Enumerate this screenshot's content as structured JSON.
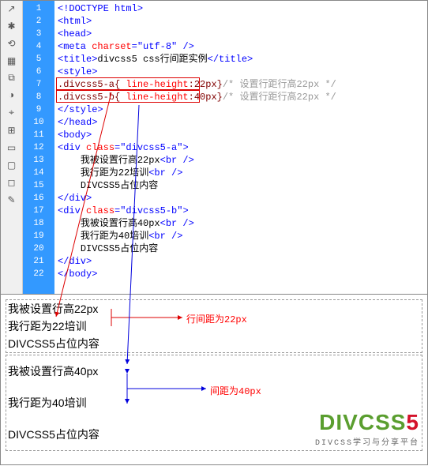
{
  "editor": {
    "line_count": 22,
    "lines": [
      {
        "indent": 0,
        "parts": [
          {
            "cls": "t-blue",
            "t": "<!DOCTYPE html>"
          }
        ]
      },
      {
        "indent": 0,
        "parts": [
          {
            "cls": "t-blue",
            "t": "<html>"
          }
        ]
      },
      {
        "indent": 0,
        "parts": [
          {
            "cls": "t-blue",
            "t": "<head>"
          }
        ]
      },
      {
        "indent": 0,
        "parts": [
          {
            "cls": "t-blue",
            "t": "<meta "
          },
          {
            "cls": "t-red",
            "t": "charset"
          },
          {
            "cls": "t-blue",
            "t": "="
          },
          {
            "cls": "t-blue",
            "t": "\"utf-8\""
          },
          {
            "cls": "t-blue",
            "t": " />"
          }
        ]
      },
      {
        "indent": 0,
        "parts": [
          {
            "cls": "t-blue",
            "t": "<title>"
          },
          {
            "cls": "t-black",
            "t": "divcss5 css行间距实例"
          },
          {
            "cls": "t-blue",
            "t": "</title>"
          }
        ]
      },
      {
        "indent": 0,
        "parts": [
          {
            "cls": "t-blue",
            "t": "<style>"
          }
        ]
      },
      {
        "indent": 0,
        "parts": [
          {
            "cls": "t-brown",
            "t": ".divcss5-a{ "
          },
          {
            "cls": "t-red",
            "t": "line-height"
          },
          {
            "cls": "t-brown",
            "t": ":22px}"
          },
          {
            "cls": "t-comment",
            "t": "/* 设置行距行高22px */"
          }
        ]
      },
      {
        "indent": 0,
        "parts": [
          {
            "cls": "t-brown",
            "t": ".divcss5-b{ "
          },
          {
            "cls": "t-red",
            "t": "line-height"
          },
          {
            "cls": "t-brown",
            "t": ":40px}"
          },
          {
            "cls": "t-comment",
            "t": "/* 设置行距行高22px */"
          }
        ]
      },
      {
        "indent": 0,
        "parts": [
          {
            "cls": "t-blue",
            "t": "</style>"
          }
        ]
      },
      {
        "indent": 0,
        "parts": [
          {
            "cls": "t-blue",
            "t": "</head>"
          }
        ]
      },
      {
        "indent": 0,
        "parts": [
          {
            "cls": "t-blue",
            "t": "<body>"
          }
        ]
      },
      {
        "indent": 0,
        "parts": [
          {
            "cls": "t-blue",
            "t": "<div "
          },
          {
            "cls": "t-red",
            "t": "class"
          },
          {
            "cls": "t-blue",
            "t": "=\"divcss5-a\">"
          }
        ]
      },
      {
        "indent": 1,
        "parts": [
          {
            "cls": "t-black",
            "t": "我被设置行高22px"
          },
          {
            "cls": "t-blue",
            "t": "<br />"
          }
        ]
      },
      {
        "indent": 1,
        "parts": [
          {
            "cls": "t-black",
            "t": "我行距为22培训"
          },
          {
            "cls": "t-blue",
            "t": "<br />"
          }
        ]
      },
      {
        "indent": 1,
        "parts": [
          {
            "cls": "t-black",
            "t": "DIVCSS5占位内容"
          }
        ]
      },
      {
        "indent": 0,
        "parts": [
          {
            "cls": "t-blue",
            "t": "</div>"
          }
        ]
      },
      {
        "indent": 0,
        "parts": [
          {
            "cls": "t-blue",
            "t": "<div "
          },
          {
            "cls": "t-red",
            "t": "class"
          },
          {
            "cls": "t-blue",
            "t": "=\"divcss5-b\">"
          }
        ]
      },
      {
        "indent": 1,
        "parts": [
          {
            "cls": "t-black",
            "t": "我被设置行高40px"
          },
          {
            "cls": "t-blue",
            "t": "<br />"
          }
        ]
      },
      {
        "indent": 1,
        "parts": [
          {
            "cls": "t-black",
            "t": "我行距为40培训"
          },
          {
            "cls": "t-blue",
            "t": "<br />"
          }
        ]
      },
      {
        "indent": 1,
        "parts": [
          {
            "cls": "t-black",
            "t": "DIVCSS5占位内容"
          }
        ]
      },
      {
        "indent": 0,
        "parts": [
          {
            "cls": "t-blue",
            "t": "</div>"
          }
        ]
      },
      {
        "indent": 0,
        "parts": [
          {
            "cls": "t-blue",
            "t": "</body>"
          }
        ]
      }
    ],
    "box_a_line": 7,
    "box_b_line": 8
  },
  "preview": {
    "box_a": [
      "我被设置行高22px",
      "我行距为22培训",
      "DIVCSS5占位内容"
    ],
    "box_b": [
      "我被设置行高40px",
      "我行距为40培训",
      "DIVCSS5占位内容"
    ],
    "anno_22": "行间距为22px",
    "anno_40": "间距为40px"
  },
  "logo": {
    "main_left": "DIVCSS",
    "main_right": "5",
    "sub": "DIVCSS学习与分享平台"
  },
  "toolbar_icons": [
    "↗",
    "✱",
    "⟲",
    "▦",
    "⧉",
    "◑",
    "⌖",
    "⊞",
    "▭",
    "▢",
    "◻",
    "✎"
  ]
}
